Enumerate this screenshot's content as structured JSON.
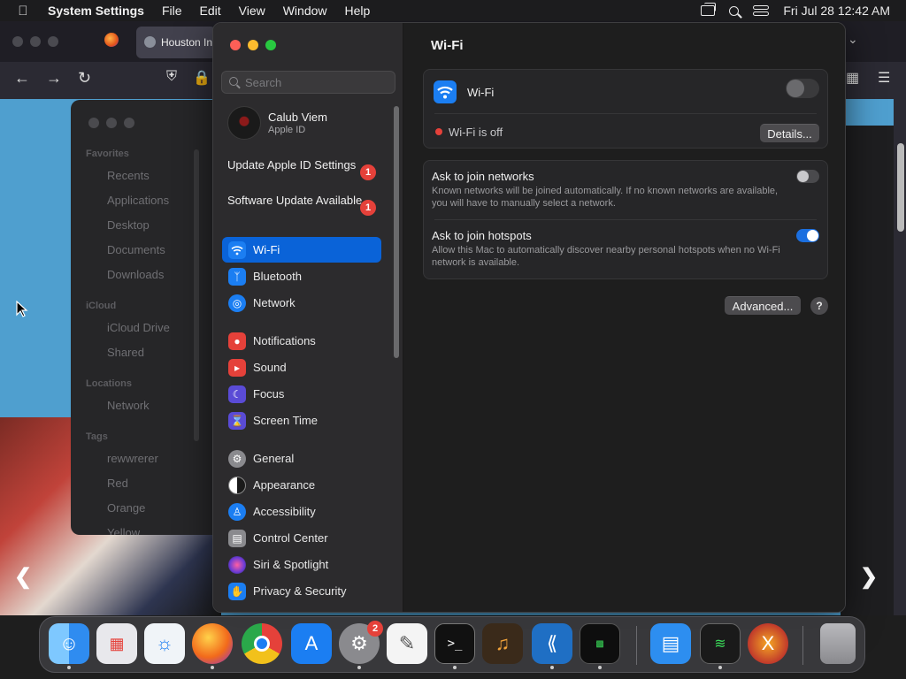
{
  "menubar": {
    "app_name": "System Settings",
    "menus": [
      "File",
      "Edit",
      "View",
      "Window",
      "Help"
    ],
    "clock": "Fri Jul 28  12:42 AM"
  },
  "browser": {
    "tab_title": "Houston In"
  },
  "finder": {
    "favorites_label": "Favorites",
    "favorites": [
      "Recents",
      "Applications",
      "Desktop",
      "Documents",
      "Downloads"
    ],
    "icloud_label": "iCloud",
    "icloud": [
      "iCloud Drive",
      "Shared"
    ],
    "locations_label": "Locations",
    "locations": [
      "Network"
    ],
    "tags_label": "Tags",
    "tags": [
      "rewwrerer",
      "Red",
      "Orange",
      "Yellow"
    ]
  },
  "settings": {
    "search_placeholder": "Search",
    "profile": {
      "name": "Calub Viem",
      "subtitle": "Apple ID"
    },
    "notices": [
      {
        "label": "Update Apple ID Settings",
        "badge": "1"
      },
      {
        "label": "Software Update Available",
        "badge": "1"
      }
    ],
    "nav_group1": [
      {
        "label": "Wi-Fi",
        "icon": "wifi-icon",
        "color": "#1b7ef2",
        "active": true
      },
      {
        "label": "Bluetooth",
        "icon": "bluetooth-icon",
        "color": "#1b7ef2"
      },
      {
        "label": "Network",
        "icon": "globe-icon",
        "color": "#1b7ef2"
      }
    ],
    "nav_group2": [
      {
        "label": "Notifications",
        "icon": "bell-icon",
        "color": "#e5413a"
      },
      {
        "label": "Sound",
        "icon": "speaker-icon",
        "color": "#e5413a"
      },
      {
        "label": "Focus",
        "icon": "moon-icon",
        "color": "#5a4bd6"
      },
      {
        "label": "Screen Time",
        "icon": "hourglass-icon",
        "color": "#5a4bd6"
      }
    ],
    "nav_group3": [
      {
        "label": "General",
        "icon": "gear-icon",
        "color": "#8a8a8e"
      },
      {
        "label": "Appearance",
        "icon": "appearance-icon",
        "color": "#1a1a1a"
      },
      {
        "label": "Accessibility",
        "icon": "accessibility-icon",
        "color": "#1b7ef2"
      },
      {
        "label": "Control Center",
        "icon": "control-center-icon",
        "color": "#8a8a8e"
      },
      {
        "label": "Siri & Spotlight",
        "icon": "siri-icon",
        "color": "#c23fd0"
      },
      {
        "label": "Privacy & Security",
        "icon": "hand-icon",
        "color": "#1b7ef2"
      }
    ],
    "pane": {
      "title": "Wi-Fi",
      "wifi_label": "Wi-Fi",
      "wifi_status": "Wi-Fi is off",
      "details_button": "Details...",
      "ask_networks_title": "Ask to join networks",
      "ask_networks_desc": "Known networks will be joined automatically. If no known networks are available, you will have to manually select a network.",
      "ask_hotspots_title": "Ask to join hotspots",
      "ask_hotspots_desc": "Allow this Mac to automatically discover nearby personal hotspots when no Wi-Fi network is available.",
      "advanced_button": "Advanced...",
      "help_button": "?"
    }
  },
  "dock": {
    "settings_badge": "2"
  }
}
